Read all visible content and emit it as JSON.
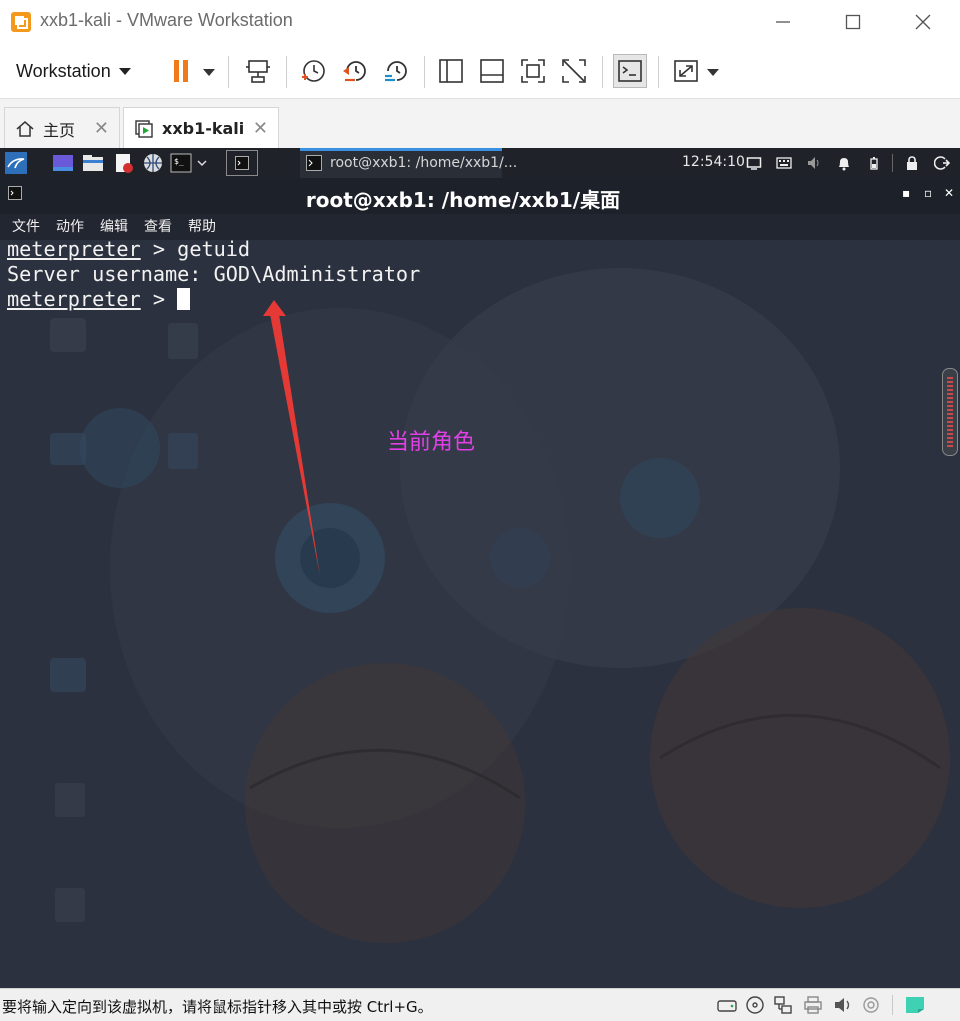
{
  "window": {
    "title": "xxb1-kali - VMware Workstation"
  },
  "toolbar": {
    "workstation_menu": "Workstation"
  },
  "tabs": [
    {
      "label": "主页"
    },
    {
      "label": "xxb1-kali"
    }
  ],
  "guest": {
    "panel": {
      "task_label": "root@xxb1: /home/xxb1/...",
      "clock": "12:54:10"
    },
    "terminal": {
      "title": "root@xxb1: /home/xxb1/桌面",
      "menu": [
        "文件",
        "动作",
        "编辑",
        "查看",
        "帮助"
      ],
      "lines": [
        {
          "prompt": "meterpreter",
          "rest": " > getuid"
        },
        {
          "text": "Server username: GOD\\Administrator"
        },
        {
          "prompt": "meterpreter",
          "rest": " > "
        }
      ]
    },
    "annotation": {
      "text": "当前角色",
      "color": "#e040e6"
    }
  },
  "statusbar": {
    "text": "要将输入定向到该虚拟机，请将鼠标指针移入其中或按 Ctrl+G。"
  },
  "colors": {
    "pause_accent": "#f07a1a",
    "snapshot_accent": "#e0531f",
    "revert_accent": "#1e8fc8",
    "arrow_red": "#e53935",
    "panel_active_task": "#3a8fe0"
  }
}
